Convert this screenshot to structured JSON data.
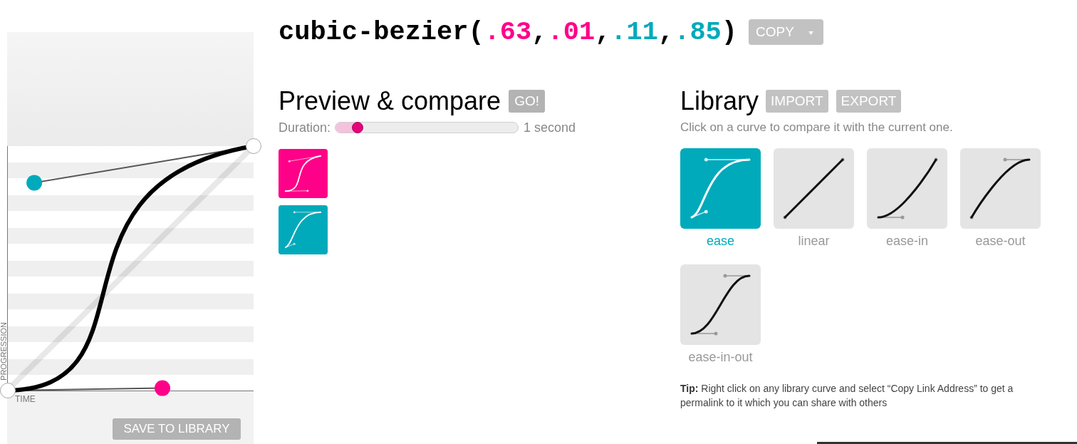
{
  "editor": {
    "y_axis_label": "PROGRESSION",
    "x_axis_label": "TIME",
    "control_points": [
      {
        "color": "#ff0088"
      },
      {
        "color": "#00aabb"
      }
    ],
    "save_button": "SAVE TO LIBRARY"
  },
  "title": {
    "parts": [
      {
        "text": "cubic-bezier(",
        "color": "#000000"
      },
      {
        "text": ".63",
        "color": "#ff0088"
      },
      {
        "text": ",",
        "color": "#000000"
      },
      {
        "text": ".01",
        "color": "#ff0088"
      },
      {
        "text": ",",
        "color": "#000000"
      },
      {
        "text": ".11",
        "color": "#00aabb"
      },
      {
        "text": ",",
        "color": "#000000"
      },
      {
        "text": ".85",
        "color": "#00aabb"
      },
      {
        "text": ")",
        "color": "#000000"
      }
    ],
    "copy_button": "COPY"
  },
  "preview": {
    "title": "Preview & compare",
    "go_button": "GO!",
    "duration_label": "Duration:",
    "duration_slider": {
      "level": 0.12
    },
    "duration_value": "1 second",
    "previews": [
      {
        "kind": "current",
        "color": "#ff0088"
      },
      {
        "kind": "comparison",
        "color": "#00aabb"
      }
    ]
  },
  "library": {
    "title": "Library",
    "buttons": [
      "IMPORT",
      "EXPORT"
    ],
    "hint": "Click on a curve to compare it with the current one.",
    "curves": [
      {
        "kind": "ease",
        "label": "ease",
        "selected": true
      },
      {
        "kind": "linear",
        "label": "linear",
        "selected": false
      },
      {
        "kind": "ease-in",
        "label": "ease-in",
        "selected": false
      },
      {
        "kind": "ease-out",
        "label": "ease-out",
        "selected": false
      },
      {
        "kind": "ease-in-out",
        "label": "ease-in-out",
        "selected": false
      }
    ],
    "tip": "**Tip:** Right click on any library curve and select “Copy Link Address” to get a permalink to it which you can share with others"
  }
}
